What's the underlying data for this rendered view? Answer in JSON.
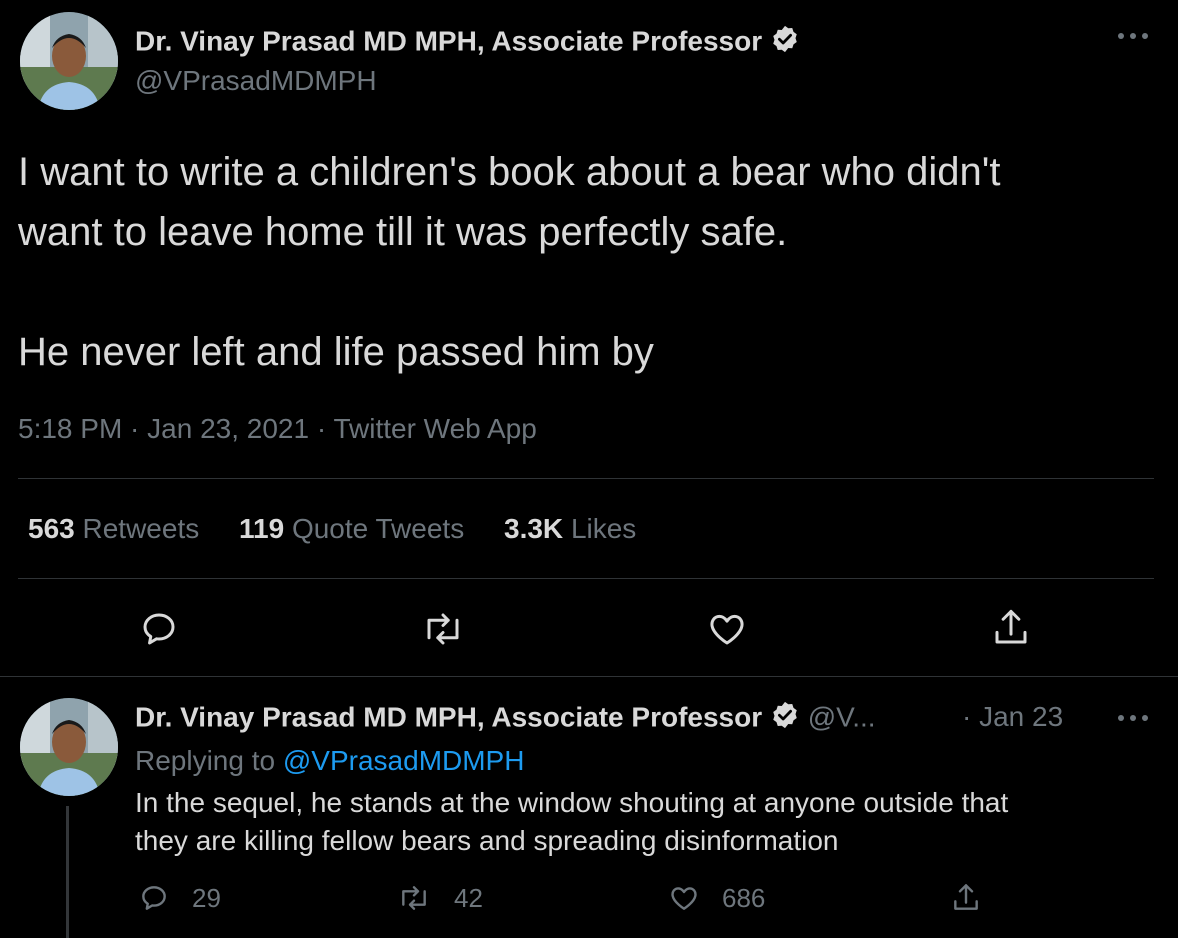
{
  "main_tweet": {
    "author_name": "Dr. Vinay Prasad MD MPH, Associate Professor",
    "handle": "@VPrasadMDMPH",
    "text_line1": "I want to write a children's book about a bear who didn't",
    "text_line2": "want to leave home till it was perfectly safe.",
    "text_line3": "He never left and life passed him by",
    "meta": "5:18 PM · Jan 23, 2021 · Twitter Web App",
    "stats": {
      "retweets_count": "563",
      "retweets_label": "Retweets",
      "quotes_count": "119",
      "quotes_label": "Quote Tweets",
      "likes_count": "3.3K",
      "likes_label": "Likes"
    },
    "more_icon": "ellipsis-icon"
  },
  "reply_tweet": {
    "author_name": "Dr. Vinay Prasad MD MPH, Associate Professor",
    "handle_truncated": "@V...",
    "date": "· Jan 23",
    "replying_prefix": "Replying to",
    "replying_handle": "@VPrasadMDMPH",
    "text_line1": "In the sequel, he stands at the window shouting at anyone outside that",
    "text_line2": "they are killing fellow bears and spreading disinformation",
    "reply_count": "29",
    "retweet_count": "42",
    "like_count": "686"
  },
  "colors": {
    "background": "#000000",
    "text": "#d9d9d9",
    "muted": "#6e767d",
    "link": "#1d9bf0",
    "divider": "#2f3336"
  }
}
